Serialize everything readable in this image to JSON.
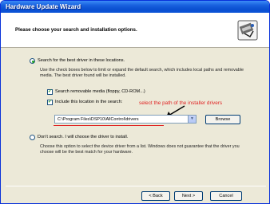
{
  "window": {
    "title": "Hardware Update Wizard"
  },
  "header": {
    "title": "Please choose your search and installation options."
  },
  "option_search": {
    "label": "Search for the best driver in these locations.",
    "description": "Use the check boxes below to limit or expand the default search, which includes local paths and removable media. The best driver found will be installed.",
    "selected": true
  },
  "checkbox_removable": {
    "label": "Search removable media (floppy, CD-ROM...)",
    "checked": true
  },
  "checkbox_include": {
    "label": "Include this location in the search:",
    "checked": true
  },
  "path_combo": {
    "value": "C:\\Program Files\\DSP10\\AllControl\\drivers"
  },
  "browse_button": {
    "label": "Browse"
  },
  "annotation": {
    "text": "select the path of the installer drivers",
    "color": "#e02424"
  },
  "option_manual": {
    "label": "Don't search. I will choose the driver to install.",
    "description": "Choose this option to select the device driver from a list. Windows does not guarantee that the driver you choose will be the best match for your hardware.",
    "selected": false
  },
  "footer": {
    "back": "< Back",
    "next": "Next >",
    "cancel": "Cancel"
  }
}
